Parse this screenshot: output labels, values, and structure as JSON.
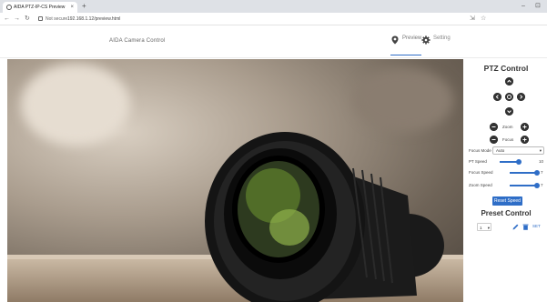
{
  "browser": {
    "tab_title": "AIDA PTZ-IP-CS Preview",
    "tab_close": "×",
    "new_tab": "+",
    "security_label": "Not secure",
    "url": "192.168.1.12/preview.html",
    "minimize": "–",
    "window_ctl": "⊡"
  },
  "app": {
    "title": "AIDA Camera Control",
    "tabs": [
      {
        "label": "Preview",
        "active": true
      },
      {
        "label": "Setting",
        "active": false
      }
    ]
  },
  "ptz": {
    "title": "PTZ Control",
    "zoom_label": "Zoom",
    "focus_label": "Focus",
    "focus_mode_label": "Focus Mode",
    "focus_mode_value": "Auto",
    "pt_speed_label": "PT Speed",
    "pt_speed_value": "10",
    "pt_speed_fraction": 0.55,
    "focus_speed_label": "Focus Speed",
    "focus_speed_value": "7",
    "focus_speed_fraction": 1.0,
    "zoom_speed_label": "Zoom Speed",
    "zoom_speed_value": "7",
    "zoom_speed_fraction": 1.0,
    "reset_label": "Reset Speed"
  },
  "preset": {
    "title": "Preset Control",
    "selected": "1",
    "set_label": "SET"
  },
  "colors": {
    "accent": "#2f6ec7",
    "dark_control": "#333333"
  }
}
